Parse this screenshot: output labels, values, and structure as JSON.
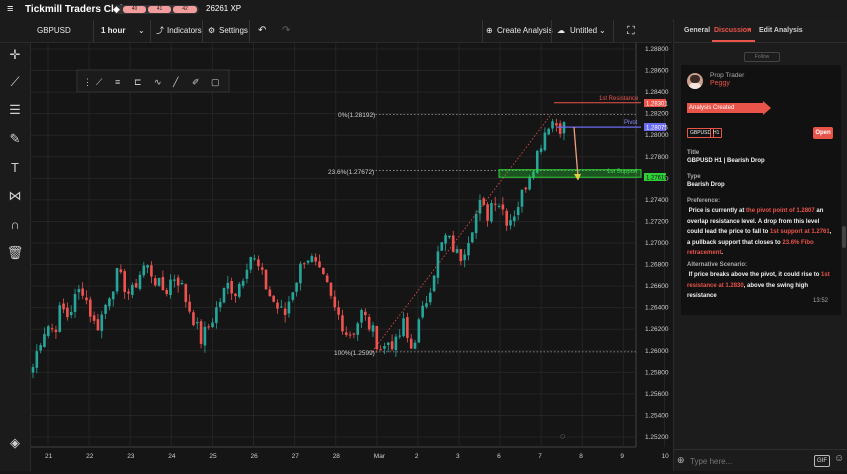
{
  "app": {
    "title": "Tickmill Traders Club",
    "xp": "26261 XP",
    "levels": [
      "40",
      "41",
      "42"
    ]
  },
  "toolbar": {
    "symbol": "GBPUSD",
    "timeframe": "1 hour",
    "indicators": "Indicators",
    "settings": "Settings",
    "create": "Create Analysis",
    "untitled": "Untitled"
  },
  "chart_data": {
    "type": "candlestick",
    "symbol": "GBPUSD",
    "ylim": [
      1.252,
      1.288
    ],
    "y_ticks": [
      "1.28800",
      "1.28600",
      "1.28400",
      "1.28200",
      "1.28000",
      "1.27800",
      "1.27600",
      "1.27400",
      "1.27200",
      "1.27000",
      "1.26800",
      "1.26600",
      "1.26400",
      "1.26200",
      "1.26000",
      "1.25800",
      "1.25600",
      "1.25400",
      "1.25200"
    ],
    "x_ticks": [
      "21",
      "22",
      "23",
      "24",
      "25",
      "26",
      "27",
      "28",
      "Mar",
      "2",
      "3",
      "6",
      "7",
      "8",
      "9",
      "10"
    ],
    "price_labels": {
      "resistance": "1.28301",
      "pivot": "1.28075",
      "support": "1.27619"
    },
    "annotations": {
      "fib0": "0%(1.28192)",
      "fib236": "23.6%(1.27672)",
      "fib100": "100%(1.2599)",
      "resistance": "1st Resistance",
      "pivot": "Pivot",
      "support": "1st Support"
    },
    "colors": {
      "up": "#26a69a",
      "down": "#ef5350",
      "accent": "#e9544a",
      "pivot": "#6b6bf0",
      "support": "#2fcf3a"
    },
    "close_path": [
      1.2585,
      1.261,
      1.2625,
      1.2618,
      1.264,
      1.2632,
      1.2648,
      1.266,
      1.264,
      1.262,
      1.2635,
      1.2655,
      1.267,
      1.2662,
      1.265,
      1.2668,
      1.268,
      1.2672,
      1.266,
      1.2655,
      1.267,
      1.2665,
      1.2645,
      1.263,
      1.261,
      1.262,
      1.2635,
      1.265,
      1.2662,
      1.2655,
      1.267,
      1.269,
      1.268,
      1.2665,
      1.265,
      1.264,
      1.2632,
      1.2655,
      1.2672,
      1.269,
      1.2683,
      1.267,
      1.266,
      1.264,
      1.263,
      1.2615,
      1.262,
      1.2635,
      1.2625,
      1.2612,
      1.26,
      1.261,
      1.2605,
      1.2625,
      1.26,
      1.262,
      1.264,
      1.2665,
      1.269,
      1.2705,
      1.2698,
      1.2685,
      1.27,
      1.272,
      1.2735,
      1.2725,
      1.2745,
      1.2735,
      1.272,
      1.273,
      1.2745,
      1.2765,
      1.278,
      1.28,
      1.2815,
      1.281,
      1.2808
    ]
  },
  "panel": {
    "tabs": [
      "General",
      "Discussion",
      "Edit Analysis"
    ],
    "follow": "Follow",
    "role": "Prop Trader",
    "user": "Peggy",
    "created": "Analysis Created",
    "badges": [
      "GBPUSD",
      "H1"
    ],
    "open": "Open",
    "title_label": "Title",
    "title": "GBPUSD H1 | Bearish Drop",
    "type_label": "Type",
    "type": "Bearish Drop",
    "pref_label": "Preference:",
    "alt_label": "Alternative Scenario:",
    "time": "13:52",
    "placeholder": "Type here...",
    "gif": "GIF"
  }
}
